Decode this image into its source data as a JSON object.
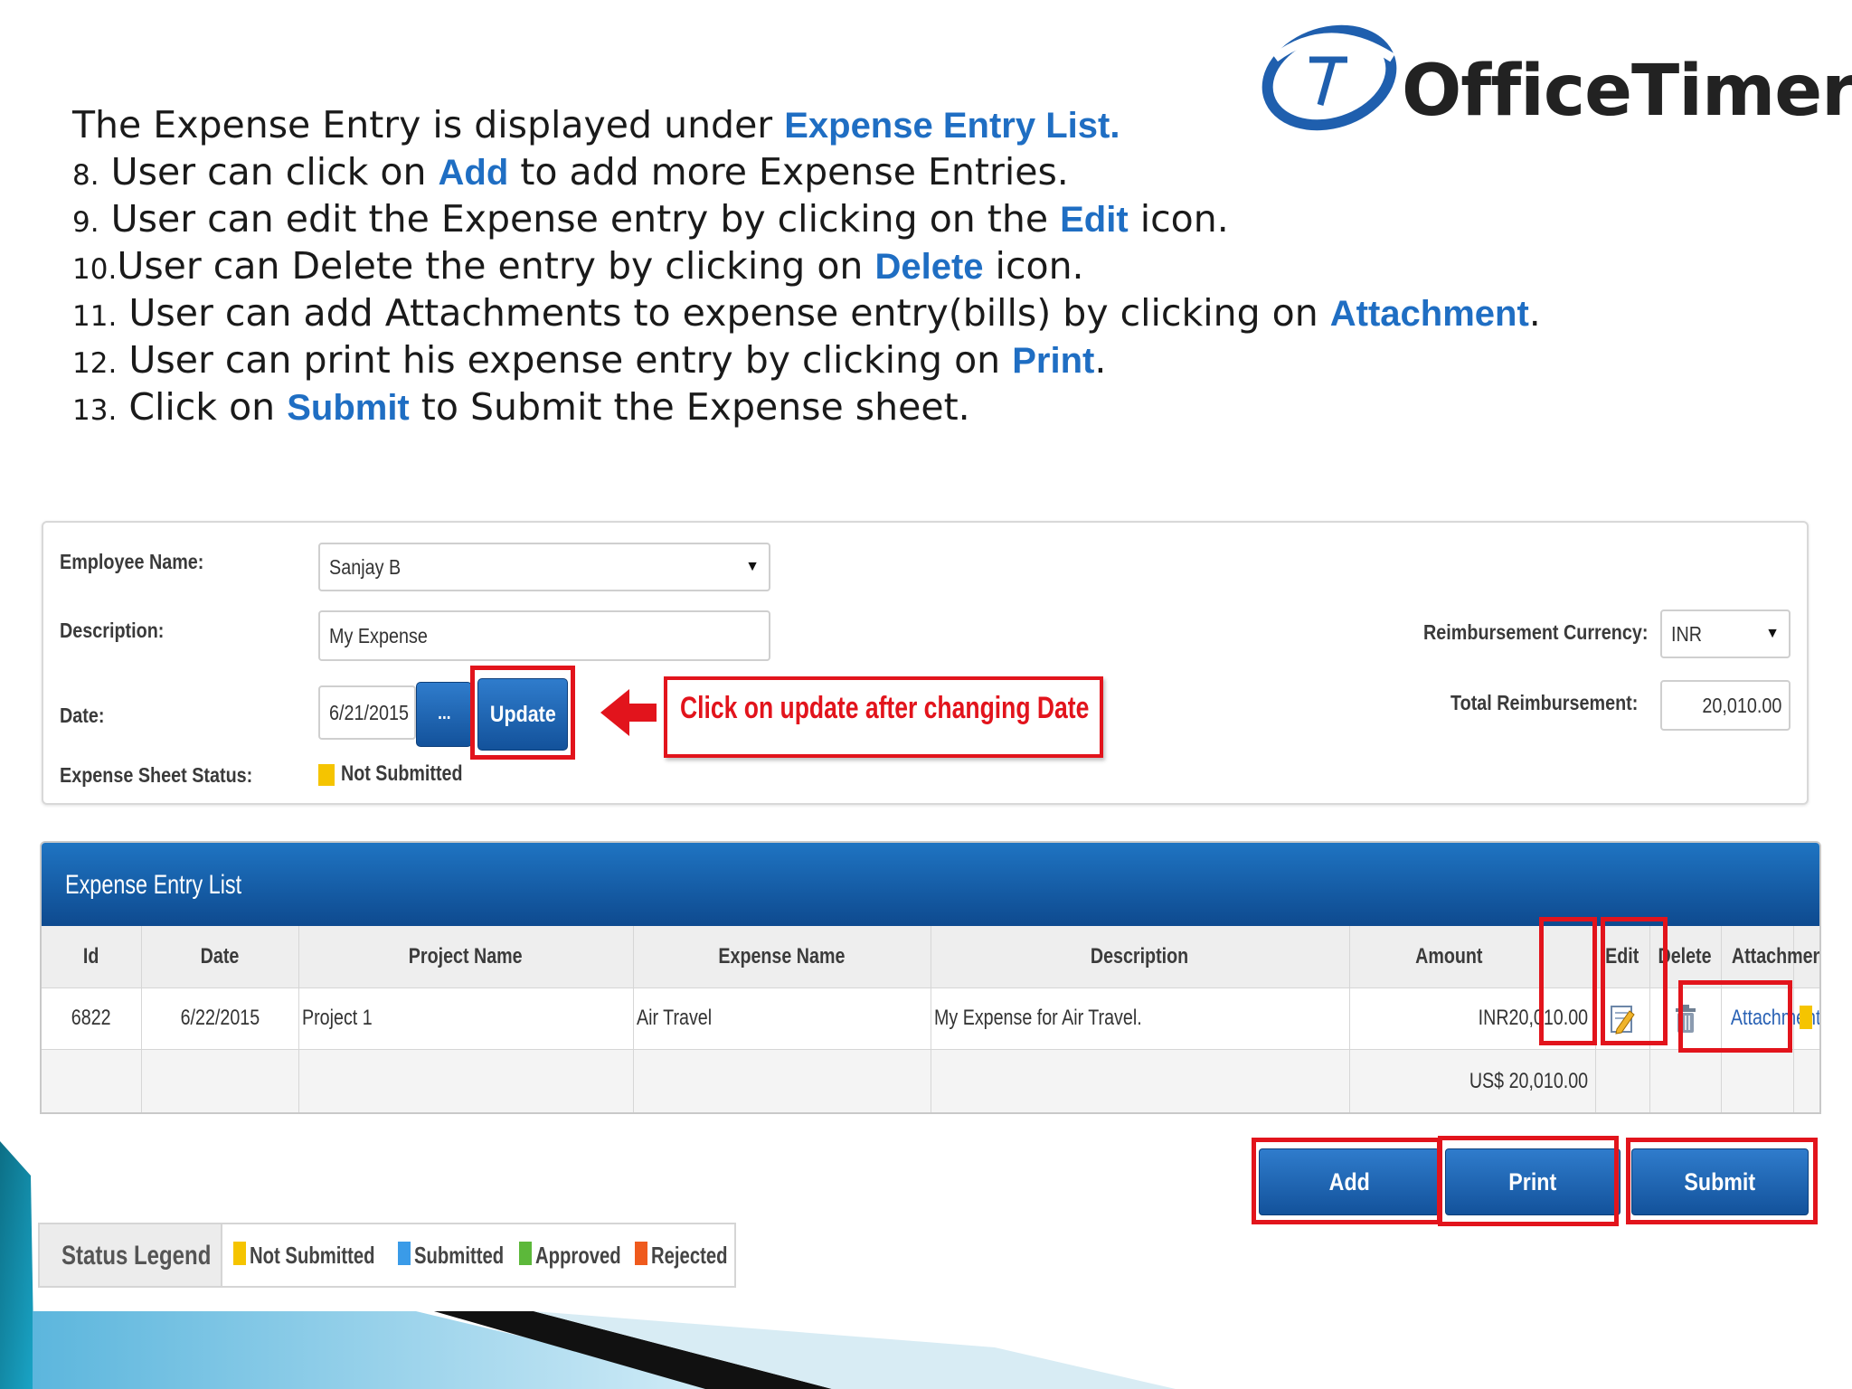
{
  "slide": {
    "intro_prefix": "The Expense Entry is displayed under ",
    "intro_keyword": "Expense Entry List.",
    "steps": [
      {
        "num": "8.",
        "pre": "User can click on ",
        "kw": "Add",
        "post": " to add more Expense Entries."
      },
      {
        "num": "9.",
        "pre": "User can edit the Expense entry by clicking on the ",
        "kw": "Edit",
        "post": " icon."
      },
      {
        "num": "10.",
        "pre": "User can Delete the entry by clicking on ",
        "kw": "Delete",
        "post": " icon."
      },
      {
        "num": "11.",
        "pre": "User can add Attachments to expense entry(bills) by clicking on ",
        "kw": "Attachment",
        "post": "."
      },
      {
        "num": "12.",
        "pre": "User can print his expense entry by clicking on ",
        "kw": "Print",
        "post": "."
      },
      {
        "num": "13.",
        "pre": "Click on ",
        "kw": "Submit",
        "post": " to Submit the Expense sheet."
      }
    ]
  },
  "logo": {
    "text": "OfficeTimer"
  },
  "form": {
    "employee_label": "Employee Name:",
    "employee_value": "Sanjay B",
    "description_label": "Description:",
    "description_value": "My Expense",
    "date_label": "Date:",
    "date_value": "6/21/2015",
    "date_picker_label": "...",
    "update_label": "Update",
    "status_label": "Expense Sheet Status:",
    "status_value": "Not Submitted",
    "currency_label": "Reimbursement Currency:",
    "currency_value": "INR",
    "total_label": "Total Reimbursement:",
    "total_value": "20,010.00",
    "callout": "Click on update after changing Date"
  },
  "list": {
    "title": "Expense Entry List",
    "headers": {
      "id": "Id",
      "date": "Date",
      "project": "Project Name",
      "expense": "Expense Name",
      "description": "Description",
      "amount": "Amount",
      "edit": "Edit",
      "delete": "Delete",
      "attachment": "Attachment"
    },
    "rows": [
      {
        "id": "6822",
        "date": "6/22/2015",
        "project": "Project 1",
        "expense": "Air Travel",
        "description": "My Expense for Air Travel.",
        "amount": "INR20,010.00",
        "attachment": "Attachment"
      }
    ],
    "total_usd": "US$ 20,010.00"
  },
  "actions": {
    "add": "Add",
    "print": "Print",
    "submit": "Submit"
  },
  "legend": {
    "title": "Status Legend",
    "items": [
      {
        "label": "Not Submitted",
        "color": "#f5c400"
      },
      {
        "label": "Submitted",
        "color": "#3a9be8"
      },
      {
        "label": "Approved",
        "color": "#5cb83a"
      },
      {
        "label": "Rejected",
        "color": "#ef5a1d"
      }
    ]
  },
  "colors": {
    "keyword_blue": "#1f6ec3",
    "highlight_red": "#e2141c",
    "header_blue": "#1558a6",
    "status_yellow": "#f5c400"
  }
}
